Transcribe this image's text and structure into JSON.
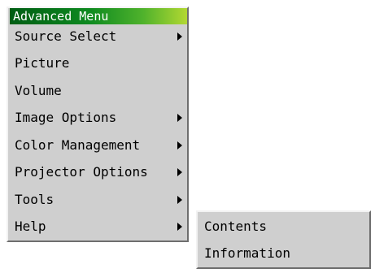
{
  "menu": {
    "title": "Advanced Menu",
    "items": [
      {
        "label": "Source Select",
        "has_submenu": true
      },
      {
        "label": "Picture",
        "has_submenu": false
      },
      {
        "label": "Volume",
        "has_submenu": false
      },
      {
        "label": "Image Options",
        "has_submenu": true
      },
      {
        "label": "Color Management",
        "has_submenu": true
      },
      {
        "label": "Projector Options",
        "has_submenu": true
      },
      {
        "label": "Tools",
        "has_submenu": true
      },
      {
        "label": "Help",
        "has_submenu": true
      }
    ]
  },
  "help_submenu": {
    "items": [
      {
        "label": "Contents"
      },
      {
        "label": "Information"
      }
    ]
  },
  "colors": {
    "menu_background": "#cfcfcf",
    "title_gradient_start": "#005d14",
    "title_gradient_end": "#b2d832",
    "text": "#000000",
    "title_text": "#ffffff"
  }
}
